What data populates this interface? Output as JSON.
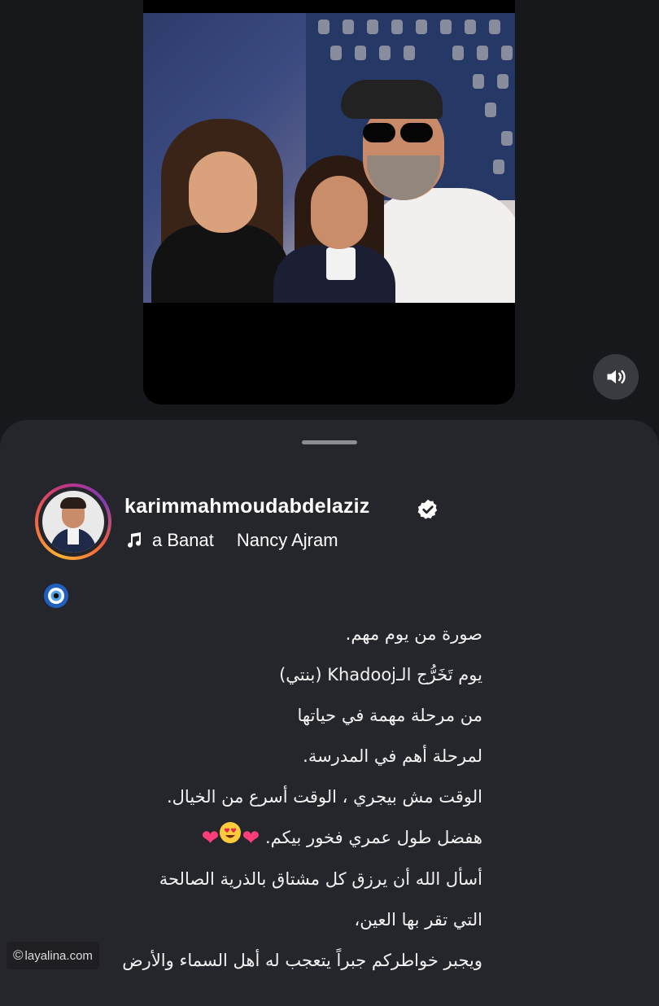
{
  "story": {
    "sound_icon": "speaker-icon"
  },
  "post": {
    "username": "karimmahmoudabdelaziz",
    "verified_icon": "verified-badge-icon",
    "music": {
      "icon": "music-note-icon",
      "song": "a Banat",
      "artist": "Nancy Ajram"
    },
    "emoji_line": "🧿",
    "caption_lines": [
      "صورة من يوم مهم.",
      "يوم تَخَرُّج الـKhadooj (بنتي)",
      "من مرحلة مهمة في حياتها",
      "لمرحلة أهم في المدرسة.",
      "الوقت مش بيجري ، الوقت أسرع من الخيال.",
      "هفضل طول عمري فخور بيكم.",
      "أسأل الله أن يرزق كل مشتاق بالذرية الصالحة",
      "التي تقر بها العين،",
      "ويجبر خواطركم جبراً يتعجب له أهل السماء والأرض"
    ],
    "caption_emojis": [
      "❤",
      "😍",
      "❤"
    ]
  },
  "watermark": {
    "symbol": "©",
    "text": "layalina.com"
  },
  "colors": {
    "background": "#17181c",
    "sheet": "#25262b",
    "text": "#ffffff",
    "heart": "#ff3e7a"
  }
}
